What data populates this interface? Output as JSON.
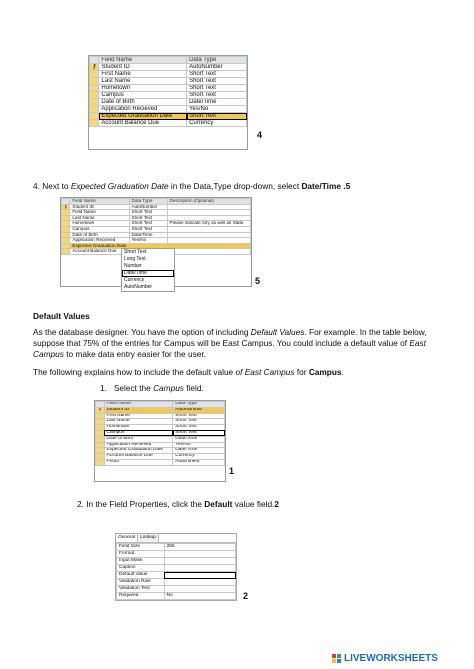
{
  "screenshot1": {
    "headers": [
      "Field Name",
      "Data Type"
    ],
    "rows": [
      [
        "Student ID",
        "AutoNumber"
      ],
      [
        "First Name",
        "Short Text"
      ],
      [
        "Last Name",
        "Short Text"
      ],
      [
        "Hometown",
        "Short Text"
      ],
      [
        "Campus",
        "Short Text"
      ],
      [
        "Date of Birth",
        "Date/Time"
      ],
      [
        "Application Recieved",
        "Yes/No"
      ],
      [
        "Expected Graduation Date",
        "Short Text"
      ],
      [
        "Account Balance Due",
        "Currency"
      ]
    ],
    "step_number": "4"
  },
  "step4": {
    "prefix": "4. Next to ",
    "field": "Expected Graduation Date",
    "middle": " in the Data,Type drop-down, select ",
    "choice": "Date/Time",
    "suffix": " .5"
  },
  "screenshot2": {
    "headers": [
      "Field Name",
      "Data Type",
      "Description (Optional)"
    ],
    "rows": [
      [
        "Student ID",
        "AutoNumber",
        ""
      ],
      [
        "Field Name",
        "Short Text",
        ""
      ],
      [
        "Last Name",
        "Short Text",
        ""
      ],
      [
        "Hometown",
        "Short Text",
        "Please indicate City as well as State."
      ],
      [
        "Campus",
        "Short Text",
        ""
      ],
      [
        "Date of Birth",
        "Date/Time",
        ""
      ],
      [
        "Application Recieved",
        "Yes/No",
        ""
      ],
      [
        "Expected Graduation Date",
        "",
        ""
      ],
      [
        "Account Balance Due",
        "",
        ""
      ]
    ],
    "dropdown": [
      "Short Text",
      "Long Text",
      "Number",
      "Date/Time",
      "Currency",
      "AutoNumber"
    ],
    "step_number": "5"
  },
  "default_values": {
    "heading": "Default Values",
    "para1_a": "As the database designer. You have the option of including ",
    "para1_em": "Default Value",
    "para1_b": "s. For example. In the table below, suppose that 75% of the entries for Campus will be East Campus. You could include a default value of ",
    "para1_em2": "East Campus",
    "para1_c": " to make data entry easier for the user.",
    "para2_a": "The following explains how to include the default value ",
    "para2_em": "of East Campus",
    "para2_b": " for ",
    "para2_strong": "Campus",
    "para2_c": ".",
    "step1_num": "1.",
    "step1_a": "Select the ",
    "step1_em": "Campus",
    "step1_b": " field."
  },
  "screenshot3": {
    "headers": [
      "Field Name",
      "Data Type"
    ],
    "rows": [
      [
        "Student ID",
        "AutoNumber"
      ],
      [
        "First Name",
        "Short Text"
      ],
      [
        "Last Name",
        "Short Text"
      ],
      [
        "Hometown",
        "Short Text"
      ],
      [
        "Campus",
        "Short Text"
      ],
      [
        "Date of Birth",
        "Date/Time"
      ],
      [
        "Application Recieved",
        "Yes/No"
      ],
      [
        "Expected Graduation Date",
        "Date/Time"
      ],
      [
        "Account Balance Due",
        "Currency"
      ],
      [
        "Photo",
        "Attachment"
      ]
    ],
    "step_number": "1"
  },
  "step2": {
    "prefix": "2. In the Field Properties, click the ",
    "strong": "Default",
    "suffix": " value field.",
    "num": "2"
  },
  "screenshot4": {
    "tabs": [
      "General",
      "Lookup"
    ],
    "rows": [
      [
        "Field Size",
        "255"
      ],
      [
        "Format",
        ""
      ],
      [
        "Input Mask",
        ""
      ],
      [
        "Caption",
        ""
      ],
      [
        "Default Value",
        ""
      ],
      [
        "Validation Rule",
        ""
      ],
      [
        "Validation Text",
        ""
      ],
      [
        "Required",
        "No"
      ]
    ],
    "step_number": "2"
  },
  "footer": {
    "brand": "LIVEWORKSHEETS"
  }
}
